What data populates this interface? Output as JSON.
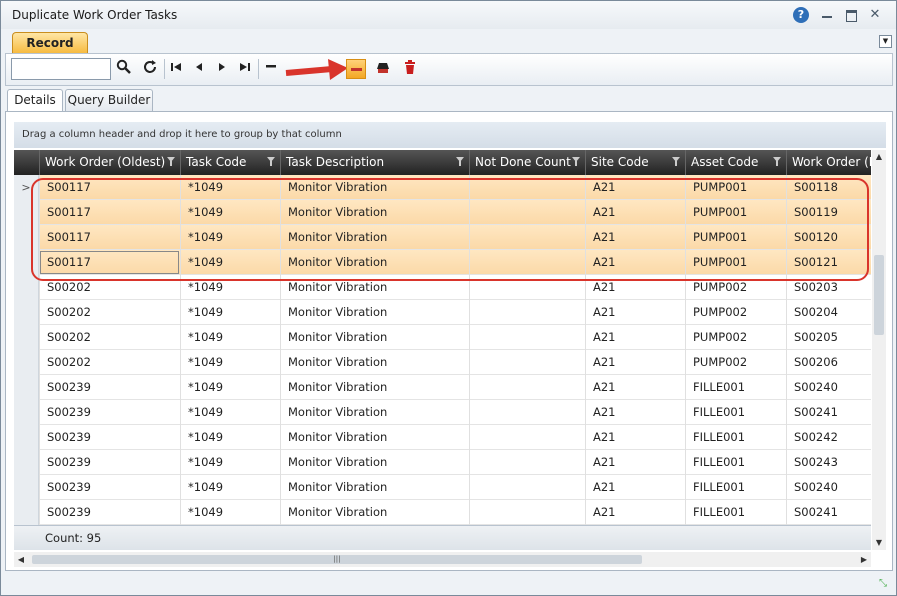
{
  "window": {
    "title": "Duplicate Work Order Tasks"
  },
  "ribbon": {
    "record_tab": "Record"
  },
  "toolbar": {
    "search_placeholder": ""
  },
  "tabs": [
    {
      "label": "Details",
      "active": true
    },
    {
      "label": "Query Builder",
      "active": false
    }
  ],
  "group_bar": "Drag a column header and drop it here to group by that column",
  "columns": [
    "Work Order (Oldest)",
    "Task Code",
    "Task Description",
    "Not Done Count",
    "Site Code",
    "Asset Code",
    "Work Order (D"
  ],
  "rows": [
    [
      "S00117",
      "*1049",
      "Monitor Vibration",
      "",
      "A21",
      "PUMP001",
      "S00118"
    ],
    [
      "S00117",
      "*1049",
      "Monitor Vibration",
      "",
      "A21",
      "PUMP001",
      "S00119"
    ],
    [
      "S00117",
      "*1049",
      "Monitor Vibration",
      "",
      "A21",
      "PUMP001",
      "S00120"
    ],
    [
      "S00117",
      "*1049",
      "Monitor Vibration",
      "",
      "A21",
      "PUMP001",
      "S00121"
    ],
    [
      "S00202",
      "*1049",
      "Monitor Vibration",
      "",
      "A21",
      "PUMP002",
      "S00203"
    ],
    [
      "S00202",
      "*1049",
      "Monitor Vibration",
      "",
      "A21",
      "PUMP002",
      "S00204"
    ],
    [
      "S00202",
      "*1049",
      "Monitor Vibration",
      "",
      "A21",
      "PUMP002",
      "S00205"
    ],
    [
      "S00202",
      "*1049",
      "Monitor Vibration",
      "",
      "A21",
      "PUMP002",
      "S00206"
    ],
    [
      "S00239",
      "*1049",
      "Monitor Vibration",
      "",
      "A21",
      "FILLE001",
      "S00240"
    ],
    [
      "S00239",
      "*1049",
      "Monitor Vibration",
      "",
      "A21",
      "FILLE001",
      "S00241"
    ],
    [
      "S00239",
      "*1049",
      "Monitor Vibration",
      "",
      "A21",
      "FILLE001",
      "S00242"
    ],
    [
      "S00239",
      "*1049",
      "Monitor Vibration",
      "",
      "A21",
      "FILLE001",
      "S00243"
    ],
    [
      "S00239",
      "*1049",
      "Monitor Vibration",
      "",
      "A21",
      "FILLE001",
      "S00240"
    ],
    [
      "S00239",
      "*1049",
      "Monitor Vibration",
      "",
      "A21",
      "FILLE001",
      "S00241"
    ]
  ],
  "highlighted_row_count": 4,
  "footer": {
    "count": "Count: 95"
  },
  "colors": {
    "accent": "#f6b93c",
    "highlight_row": "#fbd9a8",
    "annotation": "#d9342b"
  }
}
